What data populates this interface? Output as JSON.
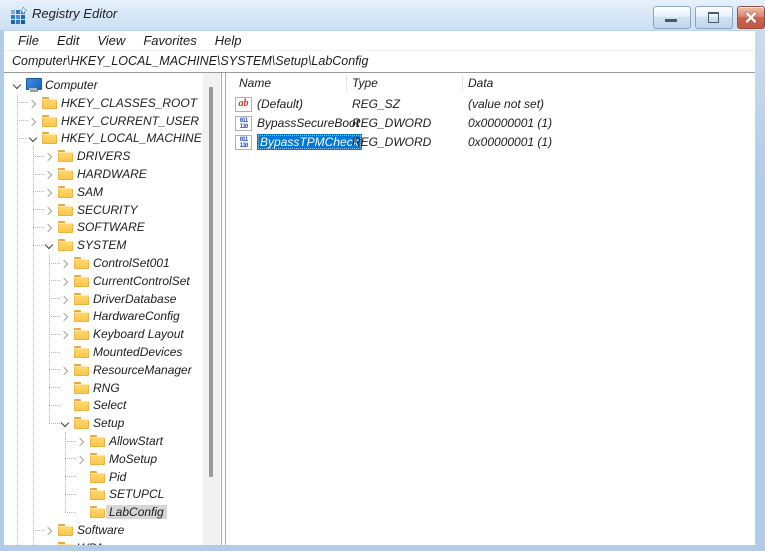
{
  "window": {
    "title": "Registry Editor",
    "controls": [
      "minimize",
      "maximize",
      "close"
    ]
  },
  "menu": [
    "File",
    "Edit",
    "View",
    "Favorites",
    "Help"
  ],
  "address_path": "Computer\\HKEY_LOCAL_MACHINE\\SYSTEM\\Setup\\LabConfig",
  "tree": [
    {
      "label": "Computer",
      "level": 0,
      "expander": "expanded",
      "icon": "computer"
    },
    {
      "label": "HKEY_CLASSES_ROOT",
      "level": 1,
      "expander": "collapsed",
      "icon": "folder"
    },
    {
      "label": "HKEY_CURRENT_USER",
      "level": 1,
      "expander": "collapsed",
      "icon": "folder"
    },
    {
      "label": "HKEY_LOCAL_MACHINE",
      "level": 1,
      "expander": "expanded",
      "icon": "folder"
    },
    {
      "label": "DRIVERS",
      "level": 2,
      "expander": "collapsed",
      "icon": "folder"
    },
    {
      "label": "HARDWARE",
      "level": 2,
      "expander": "collapsed",
      "icon": "folder"
    },
    {
      "label": "SAM",
      "level": 2,
      "expander": "collapsed",
      "icon": "folder"
    },
    {
      "label": "SECURITY",
      "level": 2,
      "expander": "collapsed",
      "icon": "folder"
    },
    {
      "label": "SOFTWARE",
      "level": 2,
      "expander": "collapsed",
      "icon": "folder"
    },
    {
      "label": "SYSTEM",
      "level": 2,
      "expander": "expanded",
      "icon": "folder"
    },
    {
      "label": "ControlSet001",
      "level": 3,
      "expander": "collapsed",
      "icon": "folder"
    },
    {
      "label": "CurrentControlSet",
      "level": 3,
      "expander": "collapsed",
      "icon": "folder"
    },
    {
      "label": "DriverDatabase",
      "level": 3,
      "expander": "collapsed",
      "icon": "folder"
    },
    {
      "label": "HardwareConfig",
      "level": 3,
      "expander": "collapsed",
      "icon": "folder"
    },
    {
      "label": "Keyboard Layout",
      "level": 3,
      "expander": "collapsed",
      "icon": "folder"
    },
    {
      "label": "MountedDevices",
      "level": 3,
      "expander": "none",
      "icon": "folder"
    },
    {
      "label": "ResourceManager",
      "level": 3,
      "expander": "collapsed",
      "icon": "folder"
    },
    {
      "label": "RNG",
      "level": 3,
      "expander": "none",
      "icon": "folder"
    },
    {
      "label": "Select",
      "level": 3,
      "expander": "none",
      "icon": "folder"
    },
    {
      "label": "Setup",
      "level": 3,
      "expander": "expanded",
      "icon": "folder"
    },
    {
      "label": "AllowStart",
      "level": 4,
      "expander": "collapsed",
      "icon": "folder"
    },
    {
      "label": "MoSetup",
      "level": 4,
      "expander": "collapsed",
      "icon": "folder"
    },
    {
      "label": "Pid",
      "level": 4,
      "expander": "none",
      "icon": "folder"
    },
    {
      "label": "SETUPCL",
      "level": 4,
      "expander": "none",
      "icon": "folder"
    },
    {
      "label": "LabConfig",
      "level": 4,
      "expander": "none",
      "icon": "folder",
      "selected": "inactive"
    },
    {
      "label": "Software",
      "level": 2,
      "expander": "collapsed",
      "icon": "folder"
    },
    {
      "label": "WPA",
      "level": 2,
      "expander": "none",
      "icon": "folder",
      "partial": true
    }
  ],
  "list": {
    "columns": [
      "Name",
      "Type",
      "Data"
    ],
    "rows": [
      {
        "icon": "string",
        "name": "(Default)",
        "type": "REG_SZ",
        "data": "(value not set)",
        "selected": false
      },
      {
        "icon": "dword",
        "name": "BypassSecureBoot",
        "type": "REG_DWORD",
        "data": "0x00000001 (1)",
        "selected": false
      },
      {
        "icon": "dword",
        "name": "BypassTPMCheck",
        "type": "REG_DWORD",
        "data": "0x00000001 (1)",
        "selected": true
      }
    ]
  },
  "icon_glyphs": {
    "string": "ab",
    "dword": "011 110"
  },
  "colors": {
    "selection": "#0078d7",
    "inactive_selection": "#d6d6d6",
    "folder_yellow": "#fbc64a",
    "titlebar_blue": "#d8e7f7",
    "frame_blue": "#b1cce9",
    "close_red": "#cd6450"
  }
}
